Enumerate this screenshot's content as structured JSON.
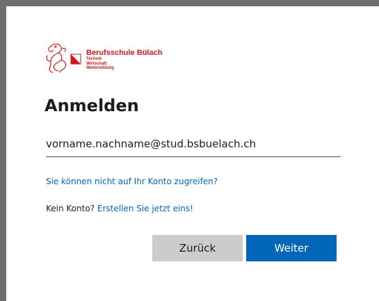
{
  "logo": {
    "title": "Berufsschule Bülach",
    "lines": [
      "Technik",
      "Wirtschaft",
      "Weiterbildung"
    ],
    "brand_color": "#d4161c"
  },
  "form": {
    "title": "Anmelden",
    "email_value": "vorname.nachname@stud.bsbuelach.ch",
    "cant_access_link": "Sie können nicht auf Ihr Konto zugreifen?",
    "no_account_text": "Kein Konto?",
    "create_link": "Erstellen Sie jetzt eins!"
  },
  "buttons": {
    "back_label": "Zurück",
    "next_label": "Weiter"
  },
  "colors": {
    "accent": "#0067b8",
    "secondary_button": "#cccccc",
    "frame": "#6f6f6f"
  }
}
